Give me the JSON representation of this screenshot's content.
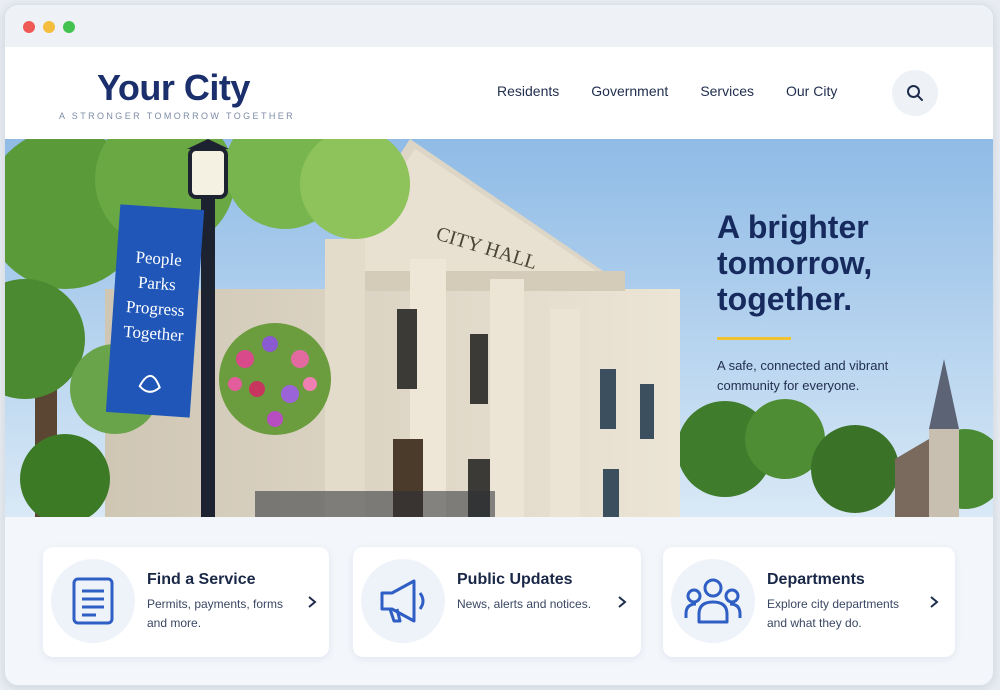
{
  "site": {
    "name": "Your City",
    "tagline": "A STRONGER TOMORROW TOGETHER"
  },
  "nav": {
    "items": [
      "Residents",
      "Government",
      "Services",
      "Our City"
    ],
    "search_icon": "search-icon"
  },
  "hero": {
    "title_line1": "A brighter",
    "title_line2": "tomorrow,",
    "title_line3": "together.",
    "subtitle": "A safe, connected and vibrant community for everyone.",
    "building_sign": "CITY HALL",
    "banner": {
      "line1": "People",
      "line2": "Parks",
      "line3": "Progress",
      "line4": "Together"
    },
    "accent_color": "#f2c230"
  },
  "cards": [
    {
      "title": "Find a Service",
      "desc": "Permits, payments, forms and more.",
      "icon": "document-icon"
    },
    {
      "title": "Public Updates",
      "desc": "News, alerts and notices.",
      "icon": "megaphone-icon"
    },
    {
      "title": "Departments",
      "desc": "Explore city departments and what they do.",
      "icon": "people-icon"
    }
  ],
  "colors": {
    "brand_navy": "#1a2f6b",
    "icon_blue": "#2f5fc4",
    "banner_blue": "#1f56b8"
  }
}
